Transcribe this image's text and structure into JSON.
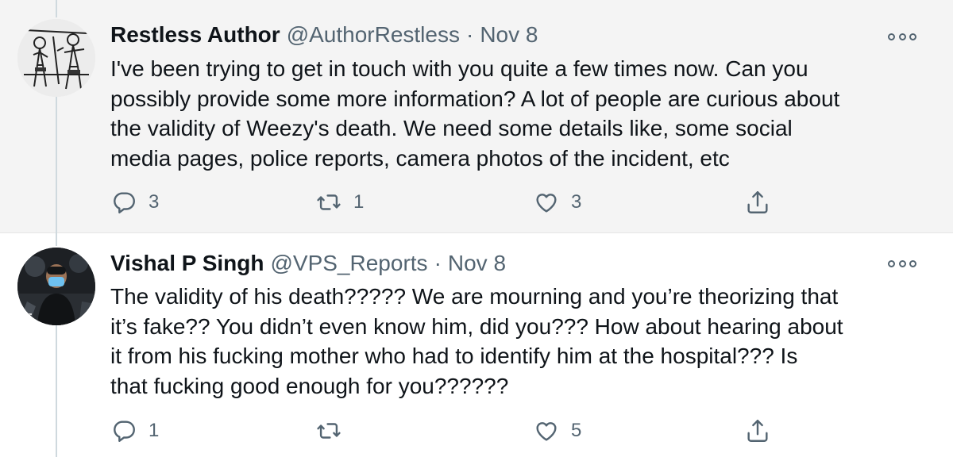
{
  "tweets": [
    {
      "display_name": "Restless Author",
      "handle": "@AuthorRestless",
      "separator": "·",
      "date": "Nov 8",
      "text": "I've been trying to get in touch with you quite a few times now. Can you\npossibly provide some more information? A lot of people are curious about\nthe validity of Weezy's death. We need some details like, some social\nmedia pages, police reports, camera photos of the incident, etc",
      "reply_count": "3",
      "retweet_count": "1",
      "like_count": "3",
      "avatar_icon": "sketch-illustration-avatar"
    },
    {
      "display_name": "Vishal P Singh",
      "handle": "@VPS_Reports",
      "separator": "·",
      "date": "Nov 8",
      "text": "The validity of his death????? We are mourning and you’re theorizing that\nit’s fake?? You didn’t even know him, did you??? How about hearing about\nit from his fucking mother who had to identify him at the hospital??? Is\nthat fucking good enough for you??????",
      "reply_count": "1",
      "retweet_count": "",
      "like_count": "5",
      "avatar_icon": "protest-photo-avatar"
    }
  ],
  "icons": {
    "more": "more-options-icon",
    "reply": "reply-icon",
    "retweet": "retweet-icon",
    "like": "like-icon",
    "share": "share-icon"
  },
  "colors": {
    "text": "#0f1419",
    "secondary": "#536471",
    "thread_line": "#cfd9de",
    "highlight_background": "#f4f4f4"
  }
}
